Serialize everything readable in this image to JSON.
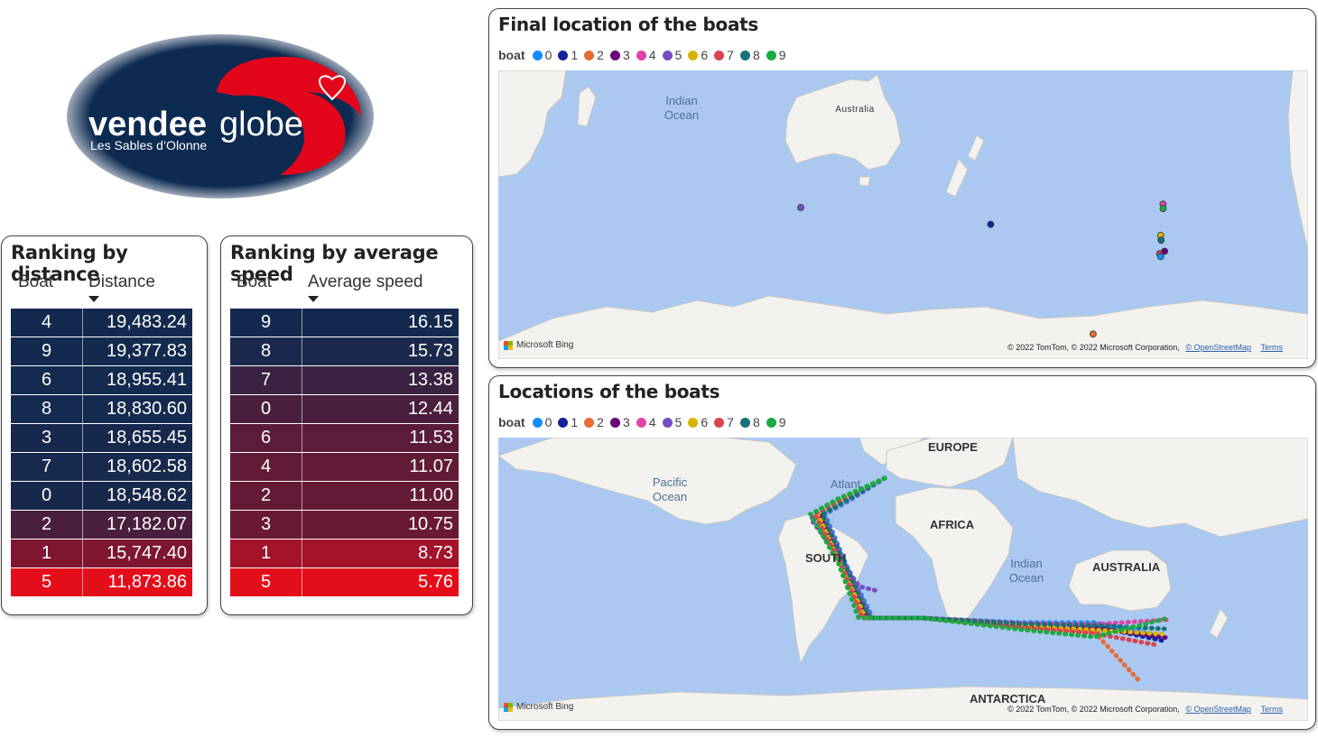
{
  "logo": {
    "brand_bold": "vendee",
    "brand_light": "globe",
    "tagline": "Les Sables d’Olonne"
  },
  "distance_table": {
    "title": "Ranking by distance",
    "col_boat": "Boat",
    "col_value": "Distance",
    "rows": [
      {
        "boat": "4",
        "value": "19,483.24",
        "color": "#132a4e"
      },
      {
        "boat": "9",
        "value": "19,377.83",
        "color": "#132a4e"
      },
      {
        "boat": "6",
        "value": "18,955.41",
        "color": "#142a4e"
      },
      {
        "boat": "8",
        "value": "18,830.60",
        "color": "#142a4e"
      },
      {
        "boat": "3",
        "value": "18,655.45",
        "color": "#16294d"
      },
      {
        "boat": "7",
        "value": "18,602.58",
        "color": "#17294c"
      },
      {
        "boat": "0",
        "value": "18,548.62",
        "color": "#18284b"
      },
      {
        "boat": "2",
        "value": "17,182.07",
        "color": "#4a1f3e"
      },
      {
        "boat": "1",
        "value": "15,747.40",
        "color": "#7e1630"
      },
      {
        "boat": "5",
        "value": "11,873.86",
        "color": "#e40e1a"
      }
    ]
  },
  "speed_table": {
    "title": "Ranking by average speed",
    "col_boat": "Boat",
    "col_value": "Average speed",
    "rows": [
      {
        "boat": "9",
        "value": "16.15",
        "color": "#132a4e"
      },
      {
        "boat": "8",
        "value": "15.73",
        "color": "#1a294b"
      },
      {
        "boat": "7",
        "value": "13.38",
        "color": "#3b2242"
      },
      {
        "boat": "0",
        "value": "12.44",
        "color": "#4a1f3e"
      },
      {
        "boat": "6",
        "value": "11.53",
        "color": "#5a1c39"
      },
      {
        "boat": "4",
        "value": "11.07",
        "color": "#621b37"
      },
      {
        "boat": "2",
        "value": "11.00",
        "color": "#641a36"
      },
      {
        "boat": "3",
        "value": "10.75",
        "color": "#6a1935"
      },
      {
        "boat": "1",
        "value": "8.73",
        "color": "#a3132a"
      },
      {
        "boat": "5",
        "value": "5.76",
        "color": "#e40e1a"
      }
    ]
  },
  "legend": {
    "title": "boat",
    "items": [
      {
        "label": "0",
        "color": "#118dff"
      },
      {
        "label": "1",
        "color": "#12239e"
      },
      {
        "label": "2",
        "color": "#e66c37"
      },
      {
        "label": "3",
        "color": "#6b007b"
      },
      {
        "label": "4",
        "color": "#e044a7"
      },
      {
        "label": "5",
        "color": "#744ec2"
      },
      {
        "label": "6",
        "color": "#d9b300"
      },
      {
        "label": "7",
        "color": "#d64550"
      },
      {
        "label": "8",
        "color": "#197278"
      },
      {
        "label": "9",
        "color": "#1aab40"
      }
    ]
  },
  "map_final": {
    "title": "Final location of the boats",
    "labels": {
      "ocean": "Indian\nOcean",
      "land": "Australia"
    },
    "points": [
      {
        "boat": "5",
        "lon": 78.5,
        "lat": -38.5
      },
      {
        "boat": "1",
        "lon": 116.5,
        "lat": -42.0
      },
      {
        "boat": "4",
        "lon": 151.0,
        "lat": -37.8
      },
      {
        "boat": "9",
        "lon": 151.0,
        "lat": -38.7
      },
      {
        "boat": "6",
        "lon": 150.5,
        "lat": -44.3
      },
      {
        "boat": "8",
        "lon": 150.6,
        "lat": -45.3
      },
      {
        "boat": "3",
        "lon": 151.3,
        "lat": -47.6
      },
      {
        "boat": "7",
        "lon": 150.3,
        "lat": -48.1
      },
      {
        "boat": "0",
        "lon": 150.5,
        "lat": -48.7
      },
      {
        "boat": "2",
        "lon": 137.0,
        "lat": -64.8
      }
    ]
  },
  "map_tracks": {
    "title": "Locations of the boats",
    "labels": {
      "europe": "EUROPE",
      "africa": "AFRICA",
      "australia": "AUSTRALIA",
      "antarctica": "ANTARCTICA",
      "south_america": "SOUTH",
      "atlantic": "Atlant",
      "pacific": "Pacific\nOcean",
      "indian": "Indian\nOcean"
    }
  },
  "attribution": {
    "bing": "Microsoft Bing",
    "copyright": "© 2022 TomTom, © 2022 Microsoft Corporation,",
    "osm": "© OpenStreetMap",
    "terms": "Terms"
  }
}
